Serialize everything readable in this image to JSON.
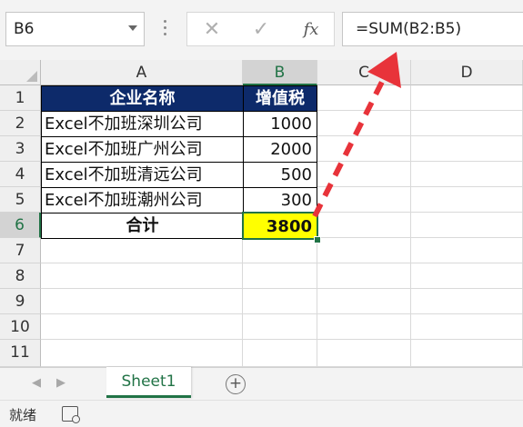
{
  "formula_bar": {
    "name_box": "B6",
    "cancel_icon": "✕",
    "enter_icon": "✓",
    "fx_label": "fx",
    "formula": "=SUM(B2:B5)"
  },
  "columns": [
    "A",
    "B",
    "C",
    "D"
  ],
  "rows": [
    "1",
    "2",
    "3",
    "4",
    "5",
    "6",
    "7",
    "8",
    "9",
    "10",
    "11"
  ],
  "table": {
    "headers": [
      "企业名称",
      "增值税"
    ],
    "data": [
      [
        "Excel不加班深圳公司",
        "1000"
      ],
      [
        "Excel不加班广州公司",
        "2000"
      ],
      [
        "Excel不加班清远公司",
        "500"
      ],
      [
        "Excel不加班潮州公司",
        "300"
      ]
    ],
    "total_label": "合计",
    "total_value": "3800"
  },
  "sheet_tabs": {
    "active": "Sheet1",
    "add": "+"
  },
  "status_bar": {
    "label": "就绪"
  },
  "colors": {
    "header_bg": "#0d2a6a",
    "highlight": "#ffff00",
    "accent": "#217346",
    "arrow": "#e8333a"
  }
}
